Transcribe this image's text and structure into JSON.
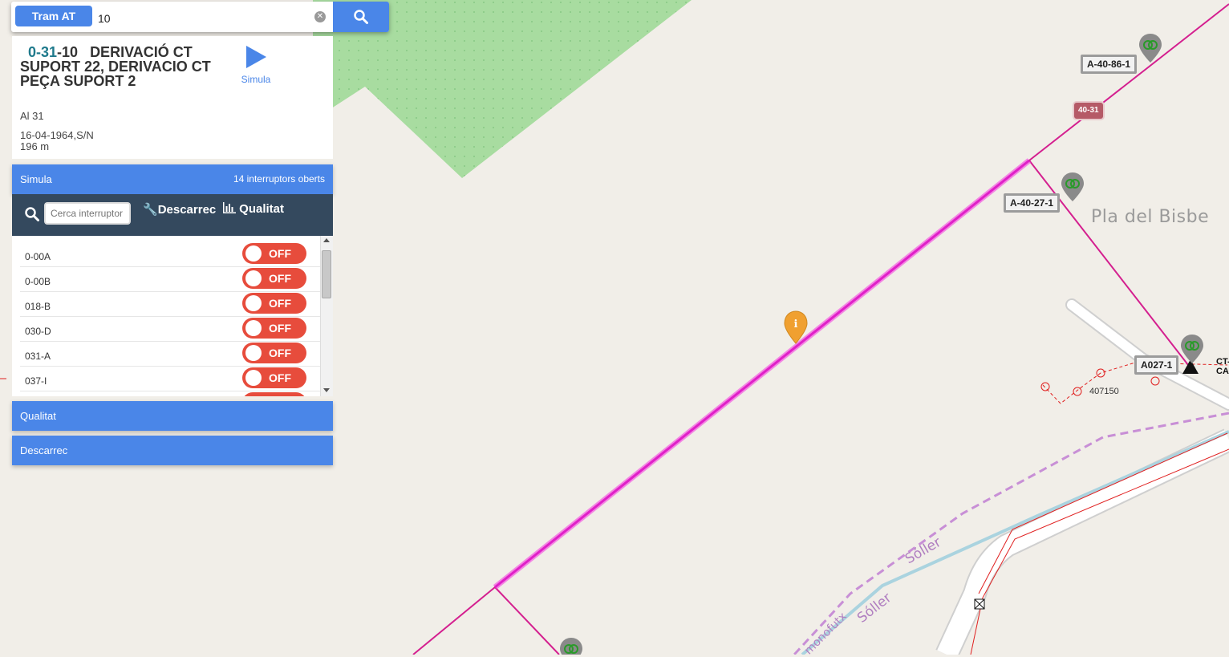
{
  "search": {
    "type_button": "Tram AT",
    "value": "10"
  },
  "info": {
    "code_prefix": "0-31",
    "code_suffix": "-10",
    "title": "DERIVACIÓ CT SUPORT 22, DERIVACIO CT PEÇA SUPORT 2",
    "line1": "Al 31",
    "line2": "16-04-1964,S/N",
    "line3": "196 m",
    "play_label": "Simula"
  },
  "simula": {
    "label": "Simula",
    "count_text": "14 interruptors oberts"
  },
  "toolbar": {
    "search_placeholder": "Cerca interruptor",
    "descarrec": "Descarrec",
    "qualitat": "Qualitat"
  },
  "switches": [
    {
      "name": "0-00A",
      "state": "OFF"
    },
    {
      "name": "0-00B",
      "state": "OFF"
    },
    {
      "name": "018-B",
      "state": "OFF"
    },
    {
      "name": "030-D",
      "state": "OFF"
    },
    {
      "name": "031-A",
      "state": "OFF"
    },
    {
      "name": "037-I",
      "state": "OFF"
    }
  ],
  "sections": {
    "qualitat": "Qualitat",
    "descarrec": "Descarrec"
  },
  "map": {
    "place_name": "Pla del Bisbe",
    "road_label_1": "Sóller",
    "road_label_2": "Sóller",
    "road_label_3": "monofutx",
    "tags": [
      "A-40-86-1",
      "A-40-27-1",
      "A027-1"
    ],
    "red_tag": "40-31",
    "ct_label_1": "CT-",
    "ct_label_2": "CA",
    "number_label": "407150",
    "colors": {
      "line": "#d41f8f",
      "highlight": "#f53fe0",
      "green_area": "#a8dca0",
      "background": "#f1eee8"
    }
  }
}
